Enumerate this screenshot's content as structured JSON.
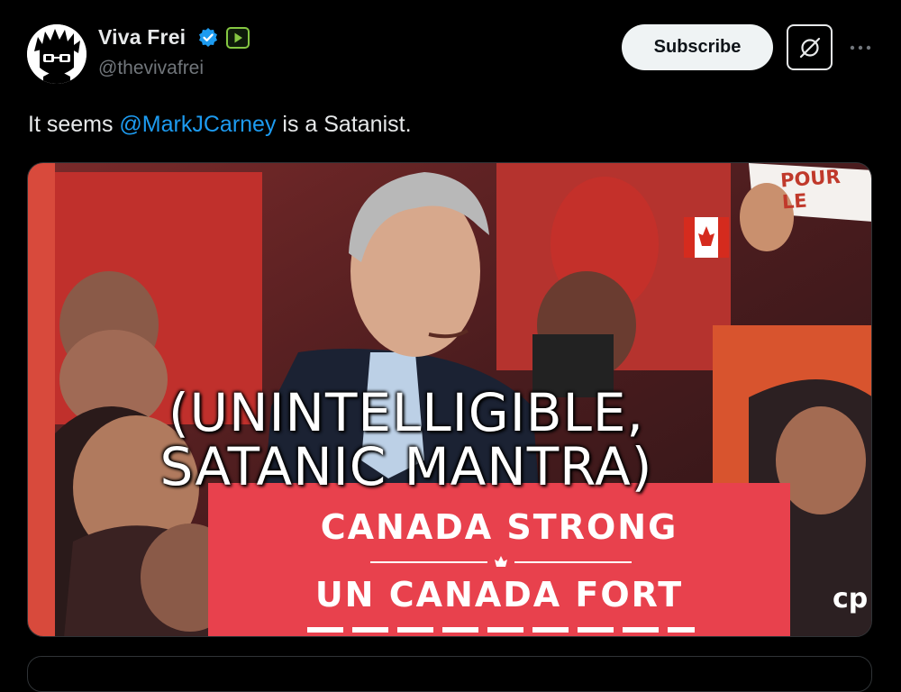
{
  "author": {
    "name": "Viva Frei",
    "handle": "@thevivafrei",
    "avatar_icon": "cartoon-face-avatar",
    "verified_icon": "verified-badge-icon",
    "extra_badge_icon": "rumble-badge-icon"
  },
  "actions": {
    "subscribe_label": "Subscribe",
    "grok_icon": "grok-icon",
    "more_icon": "more-icon"
  },
  "tweet": {
    "text_before": "It seems ",
    "mention": "@MarkJCarney",
    "text_after": " is a Satanist."
  },
  "media": {
    "caption_line1": "(UNINTELLIGIBLE,",
    "caption_line2": "SATANIC MANTRA)",
    "podium_line1": "CANADA STRONG",
    "podium_line2": "UN CANADA FORT",
    "sign_text": "POUR LE",
    "background_text": "cp"
  },
  "colors": {
    "background": "#000000",
    "text": "#e7e9ea",
    "secondary_text": "#71767b",
    "link": "#1d9bf0",
    "verified": "#1d9bf0",
    "rumble": "#85c742",
    "podium_red": "#e8414d"
  }
}
